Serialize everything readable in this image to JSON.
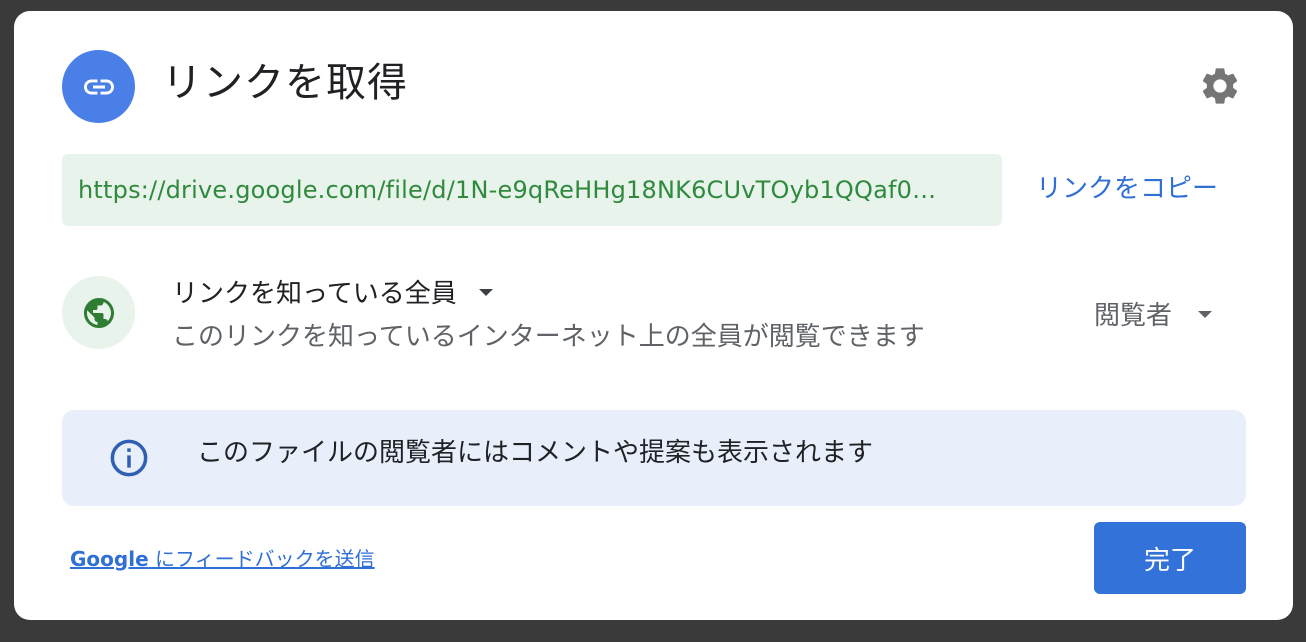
{
  "dialog": {
    "title": "リンクを取得",
    "header_icon": "link-icon",
    "settings_icon": "gear-icon"
  },
  "link": {
    "url": "https://drive.google.com/file/d/1N-e9qReHHg18NK6CUvTOyb1QQaf0…",
    "copy_label": "リンクをコピー"
  },
  "access": {
    "icon": "globe-icon",
    "scope_label": "リンクを知っている全員",
    "description": "このリンクを知っているインターネット上の全員が閲覧できます",
    "role_label": "閲覧者"
  },
  "info": {
    "icon": "info-icon",
    "text": "このファイルの閲覧者にはコメントや提案も表示されます"
  },
  "footer": {
    "feedback_brand": "Google",
    "feedback_text": " にフィードバックを送信",
    "done_label": "完了"
  },
  "colors": {
    "primary": "#3272d9",
    "link_blue": "#2f6fd6",
    "url_green": "#2f8a3e",
    "url_bg": "#e8f3eb",
    "info_bg": "#e8effb",
    "header_icon_bg": "#4a7fe8"
  }
}
